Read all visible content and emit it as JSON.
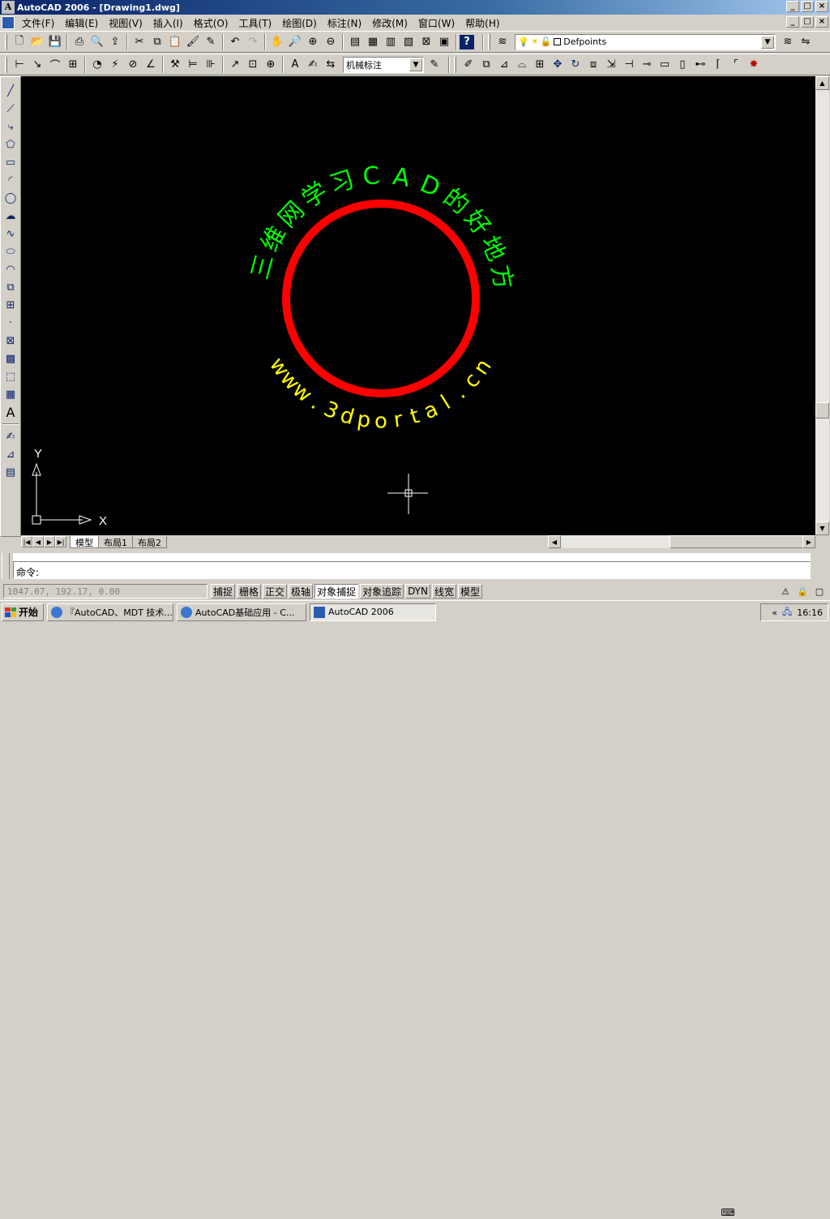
{
  "app": {
    "title": "AutoCAD 2006 - [Drawing1.dwg]",
    "logo_letter": "A",
    "window_buttons": [
      "_",
      "□",
      "×"
    ]
  },
  "menu": [
    "文件(F)",
    "编辑(E)",
    "视图(V)",
    "插入(I)",
    "格式(O)",
    "工具(T)",
    "绘图(D)",
    "标注(N)",
    "修改(M)",
    "窗口(W)",
    "帮助(H)"
  ],
  "layer_combo": {
    "value": "Defpoints"
  },
  "dimstyle_combo": {
    "value": "机械标注"
  },
  "canvas": {
    "bg": "#000000",
    "arc_text_top": [
      "三",
      "维",
      "网",
      "学",
      "习",
      "C",
      "A",
      "D",
      "的",
      "好",
      "地",
      "方"
    ],
    "arc_text_bottom": [
      "w",
      "w",
      "w",
      ".",
      "3",
      "d",
      "p",
      "o",
      "r",
      "t",
      "a",
      "l",
      ".",
      "c",
      "n"
    ],
    "top_text_color": "#00ff00",
    "bottom_text_color": "#ffff00",
    "circle_color": "#ff0000",
    "ucs_x_label": "X",
    "ucs_y_label": "Y"
  },
  "layout_tabs": [
    "模型",
    "布局1",
    "布局2"
  ],
  "command": {
    "prompt": "命令:"
  },
  "status": {
    "coords": "1047.07, 192.17, 0.00",
    "toggles": [
      {
        "label": "捕捉",
        "on": false
      },
      {
        "label": "栅格",
        "on": false
      },
      {
        "label": "正交",
        "on": false
      },
      {
        "label": "极轴",
        "on": false
      },
      {
        "label": "对象捕捉",
        "on": true
      },
      {
        "label": "对象追踪",
        "on": false
      },
      {
        "label": "DYN",
        "on": false
      },
      {
        "label": "线宽",
        "on": false
      },
      {
        "label": "模型",
        "on": false
      }
    ]
  },
  "taskbar": {
    "start_label": "开始",
    "tasks": [
      {
        "label": "『AutoCAD、MDT 技术...",
        "active": false
      },
      {
        "label": "AutoCAD基础应用 - C...",
        "active": false
      },
      {
        "label": "AutoCAD 2006",
        "active": true
      }
    ],
    "clock": "16:16",
    "tray_arrow": "«"
  }
}
